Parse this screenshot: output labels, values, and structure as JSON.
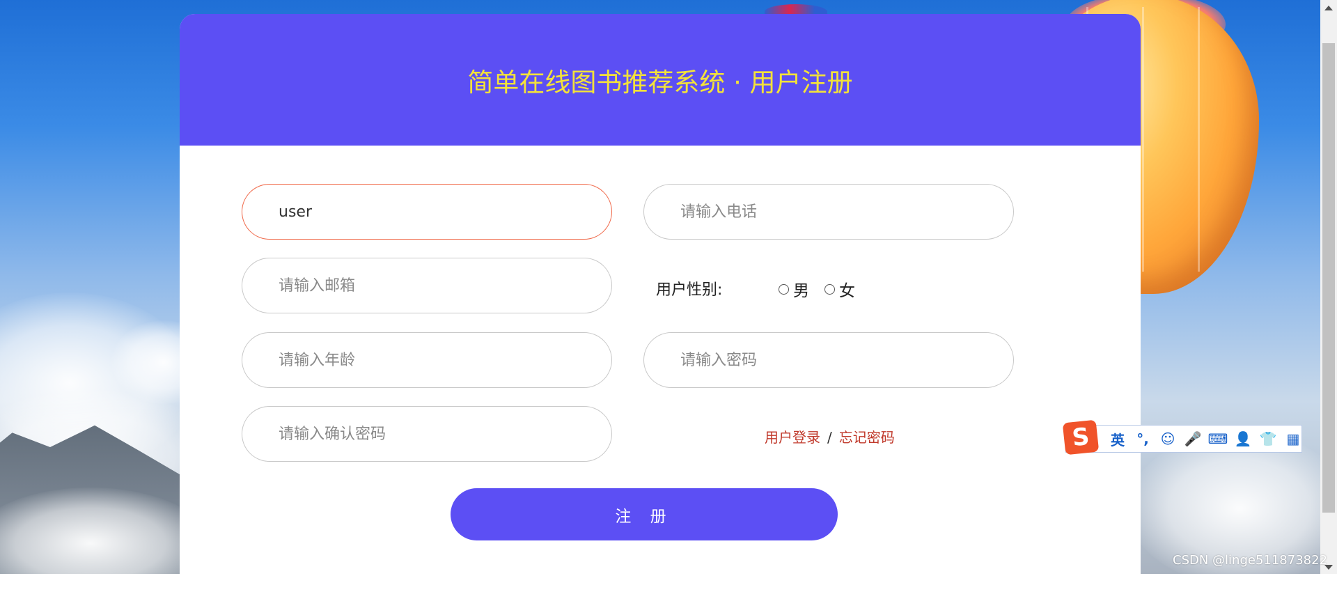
{
  "page": {
    "title": "简单在线图书推荐系统 · 用户注册"
  },
  "form": {
    "username": {
      "value": "user"
    },
    "phone": {
      "placeholder": "请输入电话"
    },
    "email": {
      "placeholder": "请输入邮箱"
    },
    "age": {
      "placeholder": "请输入年龄"
    },
    "password": {
      "placeholder": "请输入密码"
    },
    "confirm_password": {
      "placeholder": "请输入确认密码"
    },
    "gender": {
      "label": "用户性别:",
      "options": [
        "男",
        "女"
      ],
      "selected": null
    },
    "links": {
      "login": "用户登录",
      "separator": "/",
      "forgot": "忘记密码"
    },
    "submit_label": "注 册"
  },
  "ime_toolbar": {
    "logo": "S",
    "mode": "英",
    "items": [
      "°,",
      "☺",
      "🎤",
      "⌨",
      "👤",
      "👕",
      "▦"
    ]
  },
  "watermark": "CSDN @linge511873822",
  "colors": {
    "header_bg": "#5c4ff4",
    "title_text": "#f3e23a",
    "button_bg": "#5c4ff4",
    "link": "#c0392b",
    "active_border": "#f06a4b"
  }
}
